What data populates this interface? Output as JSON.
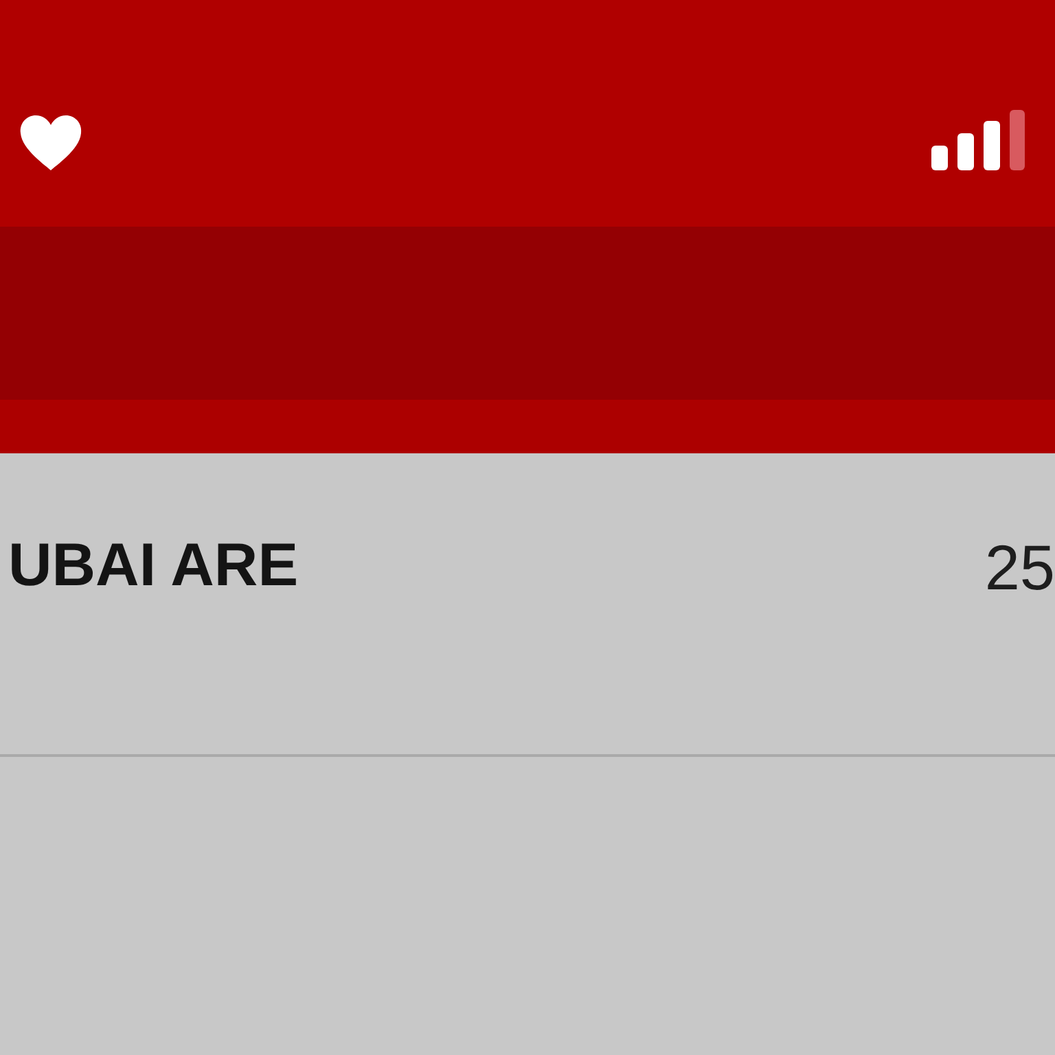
{
  "list": {
    "rows": [
      {
        "label": "UBAI ARE",
        "value": "25"
      }
    ]
  }
}
